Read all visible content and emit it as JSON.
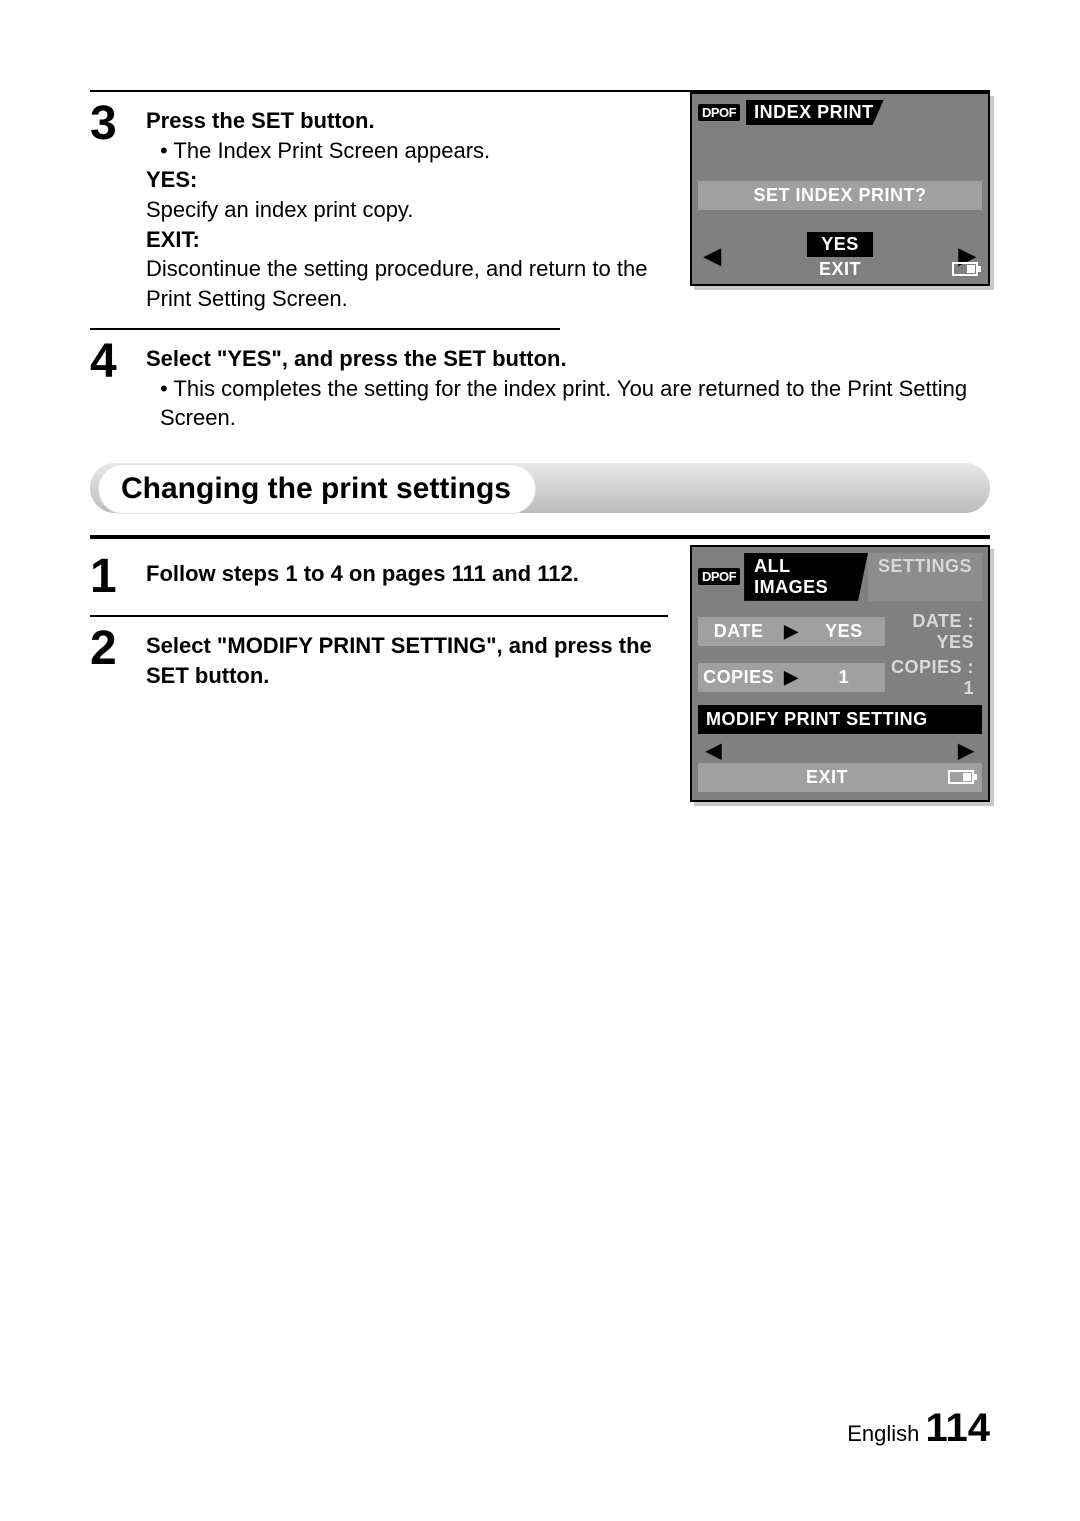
{
  "steps_a": [
    {
      "num": "3",
      "lead": "Press the SET button.",
      "bullet": "The Index Print Screen appears.",
      "yes_label": "YES:",
      "yes_text": "Specify an index print copy.",
      "exit_label": "EXIT:",
      "exit_text": "Discontinue the setting procedure, and return to the Print Setting Screen."
    },
    {
      "num": "4",
      "lead": "Select \"YES\", and press the SET button.",
      "bullet": "This completes the setting for the index print. You are returned to the Print Setting Screen."
    }
  ],
  "section_heading": "Changing the print settings",
  "steps_b": [
    {
      "num": "1",
      "lead": "Follow steps 1 to 4 on pages 111 and 112."
    },
    {
      "num": "2",
      "lead": "Select \"MODIFY PRINT SETTING\", and press the SET button."
    }
  ],
  "lcd1": {
    "dpof": "DPOF",
    "title": "INDEX PRINT",
    "prompt": "SET INDEX PRINT?",
    "yes": "YES",
    "exit": "EXIT"
  },
  "lcd2": {
    "dpof": "DPOF",
    "tab_active": "ALL IMAGES",
    "tab_inactive": "SETTINGS",
    "date_label": "DATE",
    "date_value": "YES",
    "date_summary": "DATE : YES",
    "copies_label": "COPIES",
    "copies_value": "1",
    "copies_summary": "COPIES : 1",
    "modify": "MODIFY PRINT SETTING",
    "exit": "EXIT"
  },
  "footer": {
    "lang": "English",
    "page": "114"
  }
}
